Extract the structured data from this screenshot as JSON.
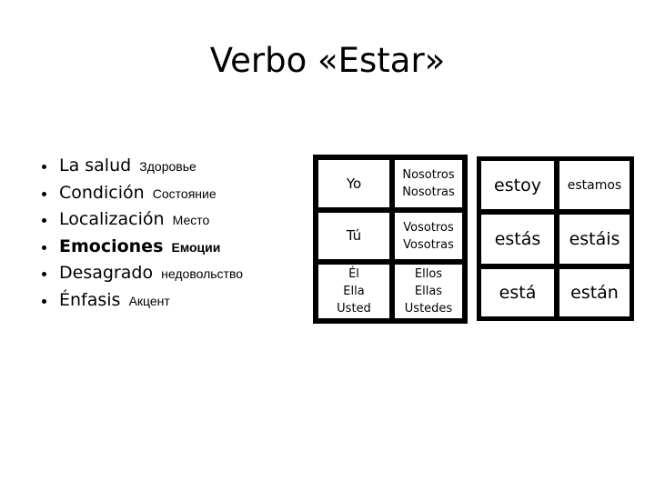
{
  "slide": {
    "title": "Verbo «Estar»"
  },
  "uses": [
    {
      "es": "La salud",
      "ru": "Здоровье",
      "bold": false
    },
    {
      "es": "Condición",
      "ru": "Состояние",
      "bold": false
    },
    {
      "es": "Localización",
      "ru": "Место",
      "bold": false
    },
    {
      "es": "Emociones",
      "ru": "Емоции",
      "bold": true
    },
    {
      "es": "Desagrado",
      "ru": "недовольство",
      "bold": false
    },
    {
      "es": "Énfasis",
      "ru": "Акцент",
      "bold": false
    }
  ],
  "pronouns": {
    "singular": [
      [
        "Yo"
      ],
      [
        "Tú"
      ],
      [
        "Él",
        "Ella",
        "Usted"
      ]
    ],
    "plural": [
      [
        "Nosotros",
        "Nosotras"
      ],
      [
        "Vosotros",
        "Vosotras"
      ],
      [
        "Ellos",
        "Ellas",
        "Ustedes"
      ]
    ]
  },
  "conjugation": {
    "singular": [
      "estoy",
      "estás",
      "está"
    ],
    "plural": [
      "estamos",
      "estáis",
      "están"
    ]
  }
}
